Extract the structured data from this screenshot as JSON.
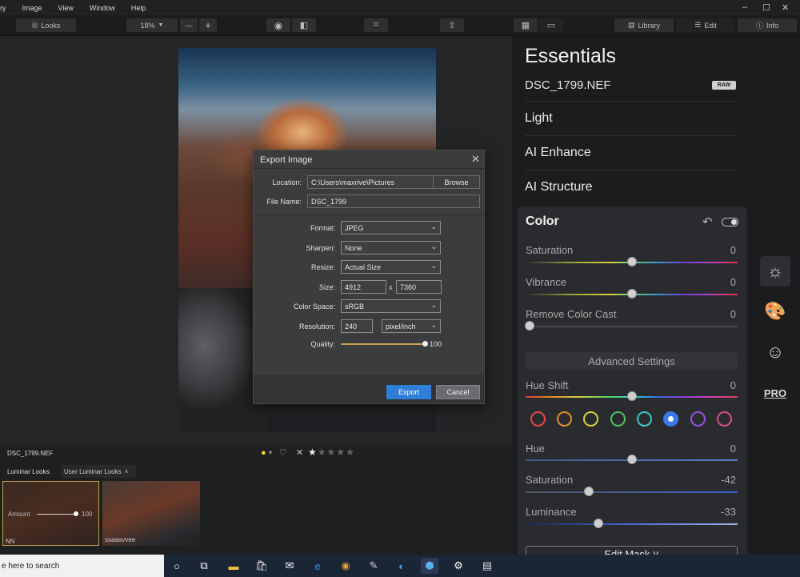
{
  "menubar": {
    "items": [
      "ry",
      "Image",
      "View",
      "Window",
      "Help"
    ],
    "minimize": "–",
    "maximize": "☐",
    "close": "✕"
  },
  "toolbar": {
    "looks_label": "Looks",
    "zoom_value": "18%",
    "zoom_minus": "—",
    "zoom_plus": "+",
    "library_label": "Library",
    "edit_label": "Edit",
    "info_label": "Info"
  },
  "export_dialog": {
    "title": "Export Image",
    "close": "✕",
    "location_label": "Location:",
    "location_value": "C:\\Users\\maxrive\\Pictures",
    "browse_label": "Browse",
    "filename_label": "File Name:",
    "filename_value": "DSC_1799",
    "format_label": "Format:",
    "format_value": "JPEG",
    "sharpen_label": "Sharpen:",
    "sharpen_value": "None",
    "resize_label": "Resize:",
    "resize_value": "Actual Size",
    "size_label": "Size:",
    "size_width": "4912",
    "size_x": "x",
    "size_height": "7360",
    "colorspace_label": "Color Space:",
    "colorspace_value": "sRGB",
    "resolution_label": "Resolution:",
    "resolution_value": "240",
    "resolution_unit": "pixel/inch",
    "quality_label": "Quality:",
    "quality_value": "100",
    "export_label": "Export",
    "cancel_label": "Cancel"
  },
  "photo_info": {
    "filename": "DSC_1799.NEF",
    "rating": 1,
    "max_rating": 5
  },
  "looks": {
    "label": "Luminar Looks:",
    "dropdown": "User Luminar Looks",
    "thumbs": [
      {
        "name": "NN",
        "amount_label": "Amount",
        "amount_value": "100"
      },
      {
        "name": "ssaaavvee"
      }
    ]
  },
  "panel": {
    "title": "Essentials",
    "filename": "DSC_1799.NEF",
    "raw_badge": "RAW",
    "sections": [
      "Light",
      "AI Enhance",
      "AI Structure"
    ],
    "color": {
      "title": "Color",
      "saturation_label": "Saturation",
      "saturation_value": "0",
      "vibrance_label": "Vibrance",
      "vibrance_value": "0",
      "remove_cast_label": "Remove Color Cast",
      "remove_cast_value": "0",
      "advanced_label": "Advanced Settings",
      "hue_shift_label": "Hue Shift",
      "hue_shift_value": "0",
      "hue_label": "Hue",
      "hue_value": "0",
      "adv_saturation_label": "Saturation",
      "adv_saturation_value": "-42",
      "luminance_label": "Luminance",
      "luminance_value": "-33",
      "edit_mask_label": "Edit Mask ˅"
    }
  },
  "side_tools": {
    "pro_label": "PRO"
  },
  "taskbar": {
    "search_placeholder": "e here to search"
  },
  "colors": {
    "accent": "#2f7fd8",
    "panel_bg": "#1b1c1e",
    "card_bg": "#2a2b2e"
  }
}
